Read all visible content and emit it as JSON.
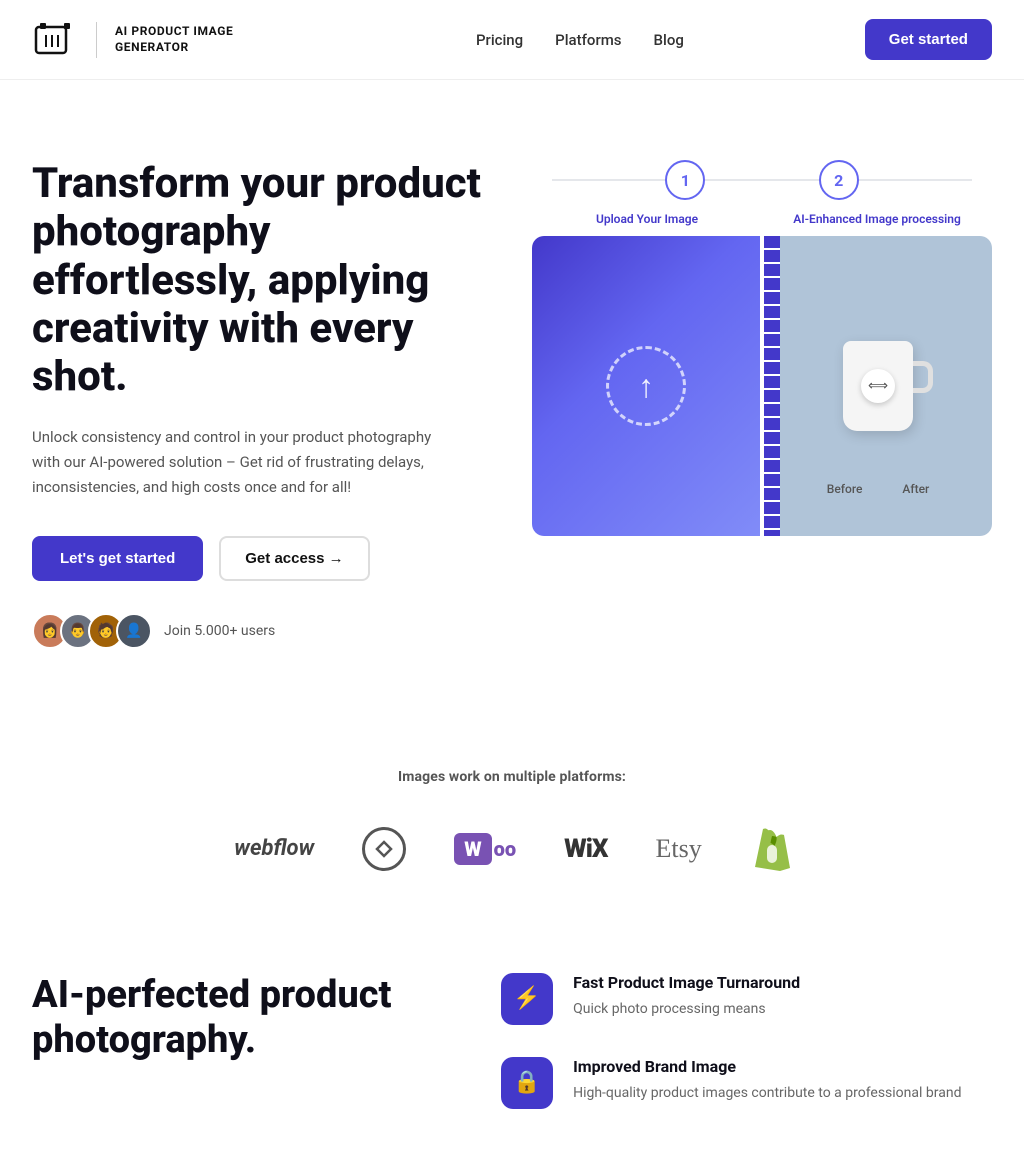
{
  "brand": {
    "name": "AI PRODUCT IMAGE GENERATOR",
    "logo_alt": "AI film logo"
  },
  "nav": {
    "links": [
      {
        "label": "Pricing",
        "href": "#pricing"
      },
      {
        "label": "Platforms",
        "href": "#platforms"
      },
      {
        "label": "Blog",
        "href": "#blog"
      }
    ],
    "cta": "Get started"
  },
  "hero": {
    "title": "Transform your product photography effortlessly, applying creativity with every shot.",
    "subtitle": "Unlock consistency and control in your product photography with our AI-powered solution – Get rid of frustrating delays, inconsistencies, and high costs once and for all!",
    "btn_primary": "Let's get started",
    "btn_secondary": "Get access →",
    "social_proof": "Join 5.000+ users",
    "step1_label": "Upload Your Image",
    "step2_label": "AI-Enhanced Image processing",
    "step1_num": "1",
    "step2_num": "2",
    "before_label": "Before",
    "after_label": "After"
  },
  "platforms": {
    "label": "Images work on multiple platforms:",
    "items": [
      {
        "name": "Webflow",
        "type": "webflow"
      },
      {
        "name": "Squarespace",
        "type": "squarespace"
      },
      {
        "name": "WooCommerce",
        "type": "woo"
      },
      {
        "name": "Wix",
        "type": "wix"
      },
      {
        "name": "Etsy",
        "type": "etsy"
      },
      {
        "name": "Shopify",
        "type": "shopify"
      }
    ]
  },
  "features": {
    "big_title": "AI-perfected product photography.",
    "items": [
      {
        "icon": "⚡",
        "title": "Fast Product Image Turnaround",
        "desc": "Quick photo processing means"
      },
      {
        "icon": "🔒",
        "title": "Improved Brand Image",
        "desc": "High-quality product images contribute to a professional brand"
      }
    ]
  }
}
